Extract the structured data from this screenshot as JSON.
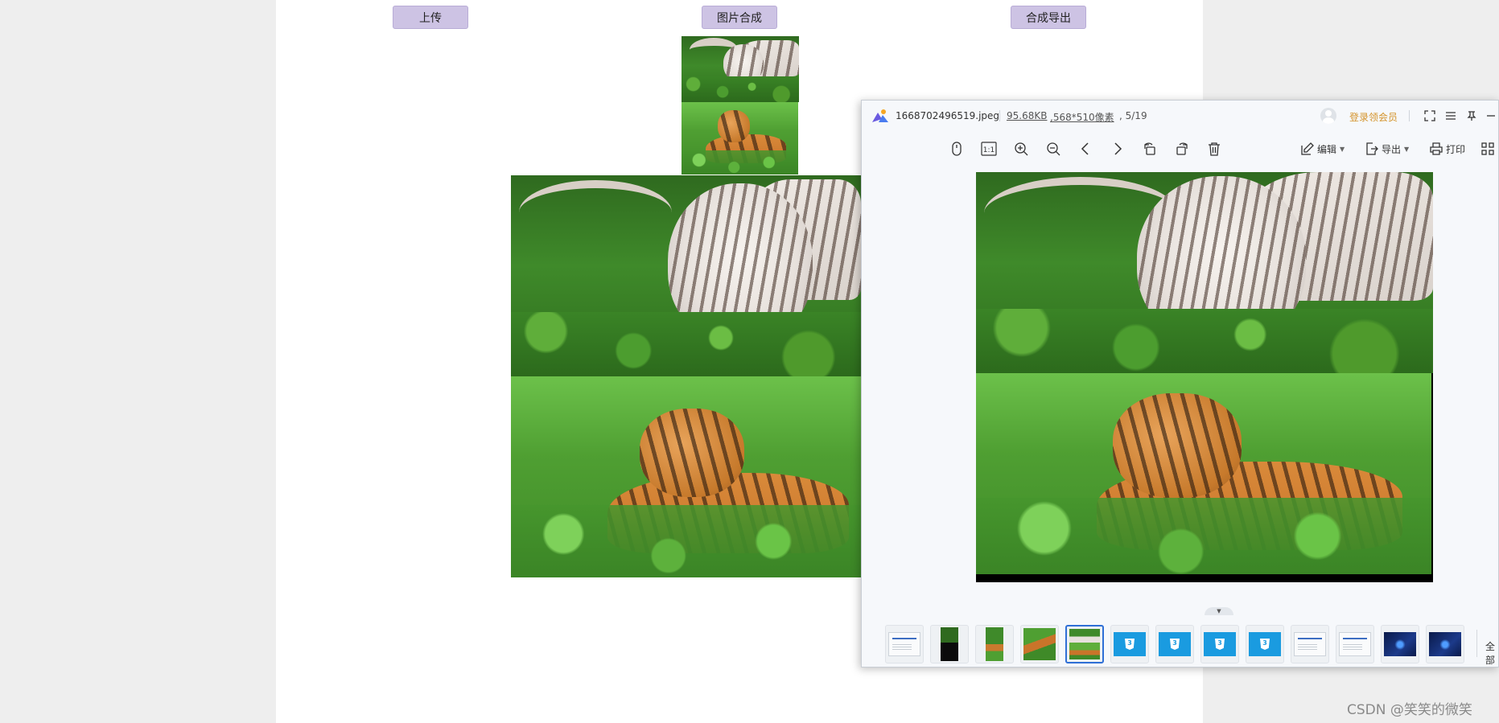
{
  "page": {
    "buttons": {
      "upload": "上传",
      "compose": "图片合成",
      "export": "合成导出"
    }
  },
  "viewer": {
    "file_name": "1668702496519.jpeg",
    "file_size": "95.68KB",
    "file_dims": ",568*510像素",
    "file_index": ", 5/19",
    "login_text": "登录领会员",
    "toolbar": {
      "edit_label": "编辑",
      "export_label": "导出",
      "print_label": "打印",
      "actual_size_label": "1:1"
    },
    "filmstrip": {
      "all_label": "全部",
      "active_index": 5
    }
  },
  "icons": [
    "app-logo-icon",
    "avatar-icon",
    "fullscreen-icon",
    "menu-icon",
    "pin-icon",
    "minimize-icon",
    "mouse-icon",
    "actual-size-icon",
    "zoom-in-icon",
    "zoom-out-icon",
    "prev-icon",
    "next-icon",
    "rotate-left-icon",
    "rotate-right-icon",
    "delete-icon",
    "edit-icon",
    "export-icon",
    "print-icon",
    "grid-icon"
  ],
  "colors": {
    "button_bg": "#cdc3e4",
    "login_link": "#d4932a",
    "active_thumb_border": "#2f6fd6"
  },
  "watermark": "CSDN @笑笑的微笑"
}
